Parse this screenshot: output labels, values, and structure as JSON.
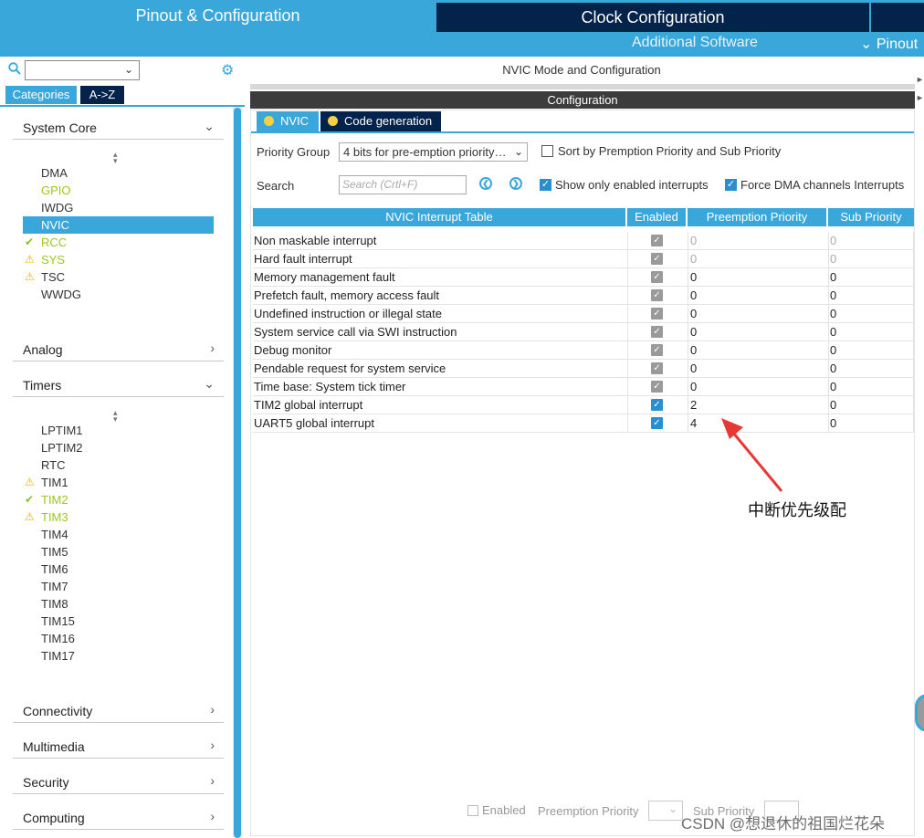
{
  "top": {
    "tab_pinout": "Pinout & Configuration",
    "tab_clock": "Clock Configuration",
    "sub_additional": "Additional Software",
    "sub_pinout": "Pinout"
  },
  "left": {
    "cat_tab": "Categories",
    "az_tab": "A->Z",
    "sections": {
      "system_core": "System Core",
      "analog": "Analog",
      "timers": "Timers",
      "connectivity": "Connectivity",
      "multimedia": "Multimedia",
      "security": "Security",
      "computing": "Computing"
    },
    "system_core_items": [
      "DMA",
      "GPIO",
      "IWDG",
      "NVIC",
      "RCC",
      "SYS",
      "TSC",
      "WWDG"
    ],
    "timer_items": [
      "LPTIM1",
      "LPTIM2",
      "RTC",
      "TIM1",
      "TIM2",
      "TIM3",
      "TIM4",
      "TIM5",
      "TIM6",
      "TIM7",
      "TIM8",
      "TIM15",
      "TIM16",
      "TIM17"
    ]
  },
  "main": {
    "mode_title": "NVIC Mode and Configuration",
    "config_title": "Configuration",
    "tab_nvic": "NVIC",
    "tab_codegen": "Code generation",
    "priority_group_label": "Priority Group",
    "priority_group_value": "4 bits for pre-emption priority…",
    "sort_label": "Sort by Premption Priority and Sub Priority",
    "search_label": "Search",
    "search_placeholder": "Search (Crtl+F)",
    "show_enabled_label": "Show only enabled interrupts",
    "force_dma_label": "Force DMA channels Interrupts",
    "table": {
      "headers": [
        "NVIC Interrupt Table",
        "Enabled",
        "Preemption Priority",
        "Sub Priority"
      ],
      "rows": [
        {
          "name": "Non maskable interrupt",
          "enabled": true,
          "pre": "0",
          "sub": "0",
          "dim": true,
          "blue": false
        },
        {
          "name": "Hard fault interrupt",
          "enabled": true,
          "pre": "0",
          "sub": "0",
          "dim": true,
          "blue": false
        },
        {
          "name": "Memory management fault",
          "enabled": true,
          "pre": "0",
          "sub": "0",
          "dim": false,
          "blue": false
        },
        {
          "name": "Prefetch fault, memory access fault",
          "enabled": true,
          "pre": "0",
          "sub": "0",
          "dim": false,
          "blue": false
        },
        {
          "name": "Undefined instruction or illegal state",
          "enabled": true,
          "pre": "0",
          "sub": "0",
          "dim": false,
          "blue": false
        },
        {
          "name": "System service call via SWI instruction",
          "enabled": true,
          "pre": "0",
          "sub": "0",
          "dim": false,
          "blue": false
        },
        {
          "name": "Debug monitor",
          "enabled": true,
          "pre": "0",
          "sub": "0",
          "dim": false,
          "blue": false
        },
        {
          "name": "Pendable request for system service",
          "enabled": true,
          "pre": "0",
          "sub": "0",
          "dim": false,
          "blue": false
        },
        {
          "name": "Time base: System tick timer",
          "enabled": true,
          "pre": "0",
          "sub": "0",
          "dim": false,
          "blue": false
        },
        {
          "name": "TIM2 global interrupt",
          "enabled": true,
          "pre": "2",
          "sub": "0",
          "dim": false,
          "blue": true
        },
        {
          "name": "UART5 global interrupt",
          "enabled": true,
          "pre": "4",
          "sub": "0",
          "dim": false,
          "blue": true
        }
      ]
    },
    "annotation": "中断优先级配",
    "bottom": {
      "enabled": "Enabled",
      "preemption": "Preemption Priority",
      "sub": "Sub Priority"
    },
    "watermark": "CSDN @想退休的祖国烂花朵"
  },
  "colors": {
    "accent": "#3aa7db",
    "navy": "#03234b",
    "ok_green": "#8fbf1a",
    "warn_yellow": "#f0b400",
    "annotation_arrow": "#e53935"
  }
}
